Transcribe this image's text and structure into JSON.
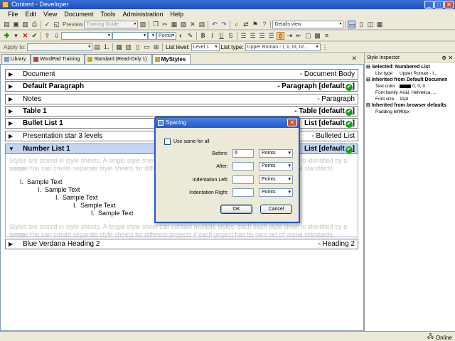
{
  "window": {
    "title": "Content - Developer",
    "minimize": "_",
    "maximize": "□",
    "close": "✕"
  },
  "menubar": {
    "items": [
      "File",
      "Edit",
      "View",
      "Document",
      "Tools",
      "Administration",
      "Help"
    ]
  },
  "toolbar": {
    "preview_label": "Preview",
    "guide_combo": "Training Guide",
    "view_combo": "Details view",
    "units_combo": "Points",
    "apply_to_label": "Apply to:",
    "list_level_label": "List level:",
    "list_level_value": "Level 1",
    "list_type_label": "List type:",
    "list_type_value": "Upper Roman - I, II, III, IV..."
  },
  "tabs": [
    {
      "label": "Library"
    },
    {
      "label": "WordPad Training"
    },
    {
      "label": "Standard (Read-Only 1)"
    },
    {
      "label": "MyStyles"
    }
  ],
  "editor": {
    "rows": [
      {
        "name": "Document",
        "kind": "- Document Body"
      },
      {
        "name": "Default Paragraph",
        "kind": "- Paragraph [default"
      },
      {
        "name": "Notes",
        "kind": "- Paragraph"
      },
      {
        "name": "Table 1",
        "kind": "- Table [default"
      },
      {
        "name": "Bullet List 1",
        "kind": "List [default"
      },
      {
        "name": "Presentation star 3 levels",
        "kind": "- Bulleted List"
      },
      {
        "name": "Number List 1",
        "kind": "List [default"
      },
      {
        "name": "Blue Verdana Heading 2",
        "kind": "- Heading 2"
      }
    ],
    "description_line1": "Styles are stored in style sheets. A single style sheet can contain multiple styles, each each style sheet is identified by a unique",
    "description_line2": "name. You can create separate style sheets for different projects if each project has its own set of visual standards.",
    "description_bottom_line1": "Styles are stored in style sheets. A single style sheet can contain multiple styles, each each style sheet is identified by a unique",
    "description_bottom_line2": "name. You can create separate style sheets for different projects if each project has its own set of visual standards.",
    "sample": [
      {
        "marker": "I.",
        "text": "Sample Text"
      },
      {
        "marker": "I.",
        "text": "Sample Text"
      },
      {
        "marker": "I.",
        "text": "Sample Text"
      },
      {
        "marker": "I.",
        "text": "Sample Text"
      },
      {
        "marker": "I.",
        "text": "Sample Text"
      }
    ]
  },
  "inspector": {
    "title": "Style Inspector",
    "pin": "⊕",
    "close": "✕",
    "sections": [
      {
        "title": "Selected: Numbered List",
        "rows": [
          {
            "k": "List type",
            "v": "Upper Roman - I..."
          }
        ]
      },
      {
        "title": "Inherited from Default Documen",
        "rows": [
          {
            "k": "Text color",
            "v": "0, 0, 0"
          },
          {
            "k": "Font family",
            "v": "Arial, Helvetica, ..."
          },
          {
            "k": "Font size",
            "v": "11pt"
          }
        ]
      },
      {
        "title": "Inherited from browser defaults",
        "rows": [
          {
            "k": "Padding left",
            "v": "40px"
          }
        ]
      }
    ]
  },
  "dialog": {
    "title": "Spacing",
    "close": "✕",
    "same_for_all_label": "Use same for all",
    "fields": [
      {
        "label": "Before:",
        "value": "6",
        "unit": "Points"
      },
      {
        "label": "After:",
        "value": "",
        "unit": "Points"
      },
      {
        "label": "Indentation Left:",
        "value": "",
        "unit": "Points"
      },
      {
        "label": "Indentation Right:",
        "value": "",
        "unit": "Points"
      }
    ],
    "ok_label": "OK",
    "cancel_label": "Cancel"
  },
  "status": {
    "online_label": "Online"
  }
}
